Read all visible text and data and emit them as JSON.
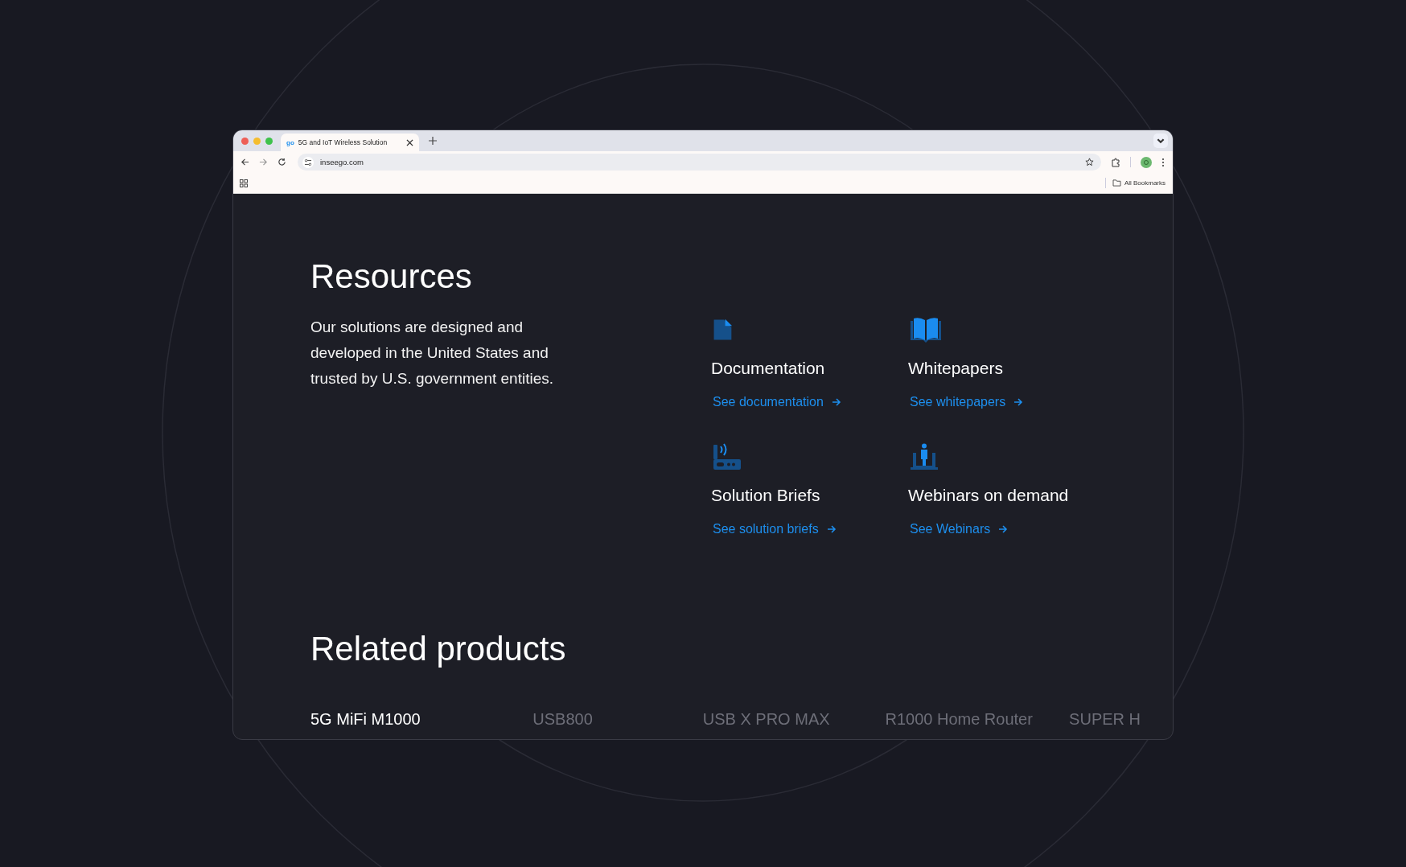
{
  "browser": {
    "tab_title": "5G and IoT Wireless Solution",
    "tab_icon_text": "go",
    "url": "inseego.com",
    "bookmarks_label": "All Bookmarks"
  },
  "resources": {
    "title": "Resources",
    "description": "Our solutions are designed and developed in the United States and trusted by U.S. government entities.",
    "items": [
      {
        "kind": "document",
        "title": "Documentation",
        "link": "See documentation"
      },
      {
        "kind": "book",
        "title": "Whitepapers",
        "link": "See whitepapers"
      },
      {
        "kind": "router",
        "title": "Solution Briefs",
        "link": "See solution briefs"
      },
      {
        "kind": "presenter",
        "title": "Webinars on demand",
        "link": "See Webinars"
      }
    ]
  },
  "related_products": {
    "title": "Related products",
    "items": [
      {
        "name": "5G MiFi M1000",
        "selected": true
      },
      {
        "name": "USB800",
        "selected": false
      },
      {
        "name": "USB X PRO MAX",
        "selected": false
      },
      {
        "name": "R1000 Home Router",
        "selected": false
      },
      {
        "name": "SUPER H",
        "selected": false
      }
    ]
  }
}
